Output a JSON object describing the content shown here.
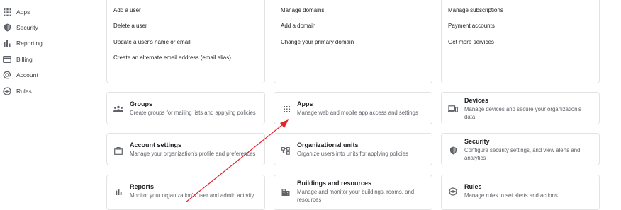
{
  "sidebar": {
    "items": [
      {
        "label": "Apps",
        "icon": "apps-grid-icon"
      },
      {
        "label": "Security",
        "icon": "shield-icon"
      },
      {
        "label": "Reporting",
        "icon": "bar-chart-icon"
      },
      {
        "label": "Billing",
        "icon": "credit-card-icon"
      },
      {
        "label": "Account",
        "icon": "at-sign-icon"
      },
      {
        "label": "Rules",
        "icon": "rules-icon"
      }
    ]
  },
  "top_cards": {
    "users": {
      "links": [
        "Add a user",
        "Delete a user",
        "Update a user's name or email",
        "Create an alternate email address (email alias)"
      ]
    },
    "domains": {
      "links": [
        "Manage domains",
        "Add a domain",
        "Change your primary domain"
      ]
    },
    "billing": {
      "links": [
        "Manage subscriptions",
        "Payment accounts",
        "Get more services"
      ]
    }
  },
  "tiles": {
    "groups": {
      "title": "Groups",
      "desc": "Create groups for mailing lists and applying policies",
      "icon": "groups-icon"
    },
    "apps": {
      "title": "Apps",
      "desc": "Manage web and mobile app access and settings",
      "icon": "apps-grid-icon"
    },
    "devices": {
      "title": "Devices",
      "desc": "Manage devices and secure your organization's data",
      "icon": "devices-icon"
    },
    "account_settings": {
      "title": "Account settings",
      "desc": "Manage your organization's profile and preferences",
      "icon": "briefcase-icon"
    },
    "org_units": {
      "title": "Organizational units",
      "desc": "Organize users into units for applying policies",
      "icon": "org-units-icon"
    },
    "security": {
      "title": "Security",
      "desc": "Configure security settings, and view alerts and analytics",
      "icon": "shield-icon"
    },
    "reports": {
      "title": "Reports",
      "desc": "Monitor your organization's user and admin activity",
      "icon": "bar-chart-icon"
    },
    "buildings": {
      "title": "Buildings and resources",
      "desc": "Manage and monitor your buildings, rooms, and resources",
      "icon": "building-icon"
    },
    "rules": {
      "title": "Rules",
      "desc": "Manage rules to set alerts and actions",
      "icon": "rules-icon"
    }
  },
  "colors": {
    "annotation_arrow": "#e3222b",
    "icon": "#5f6368",
    "border": "#e3e3e3"
  }
}
